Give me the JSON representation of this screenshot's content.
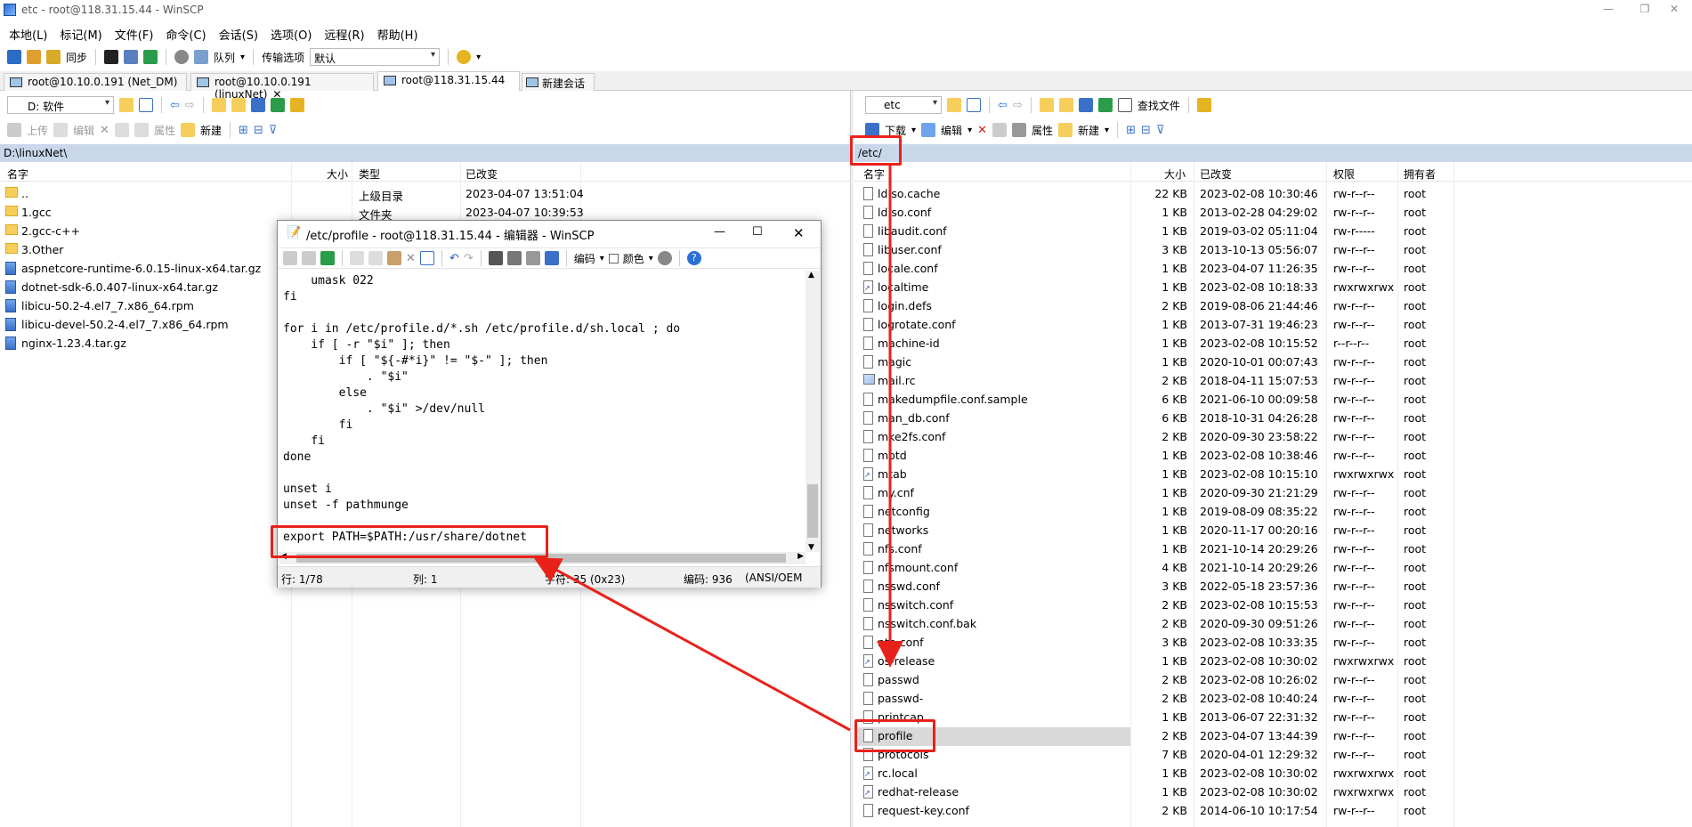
{
  "window": {
    "title": "etc - root@118.31.15.44 - WinSCP",
    "min": "—",
    "max": "❐",
    "close": "✕"
  },
  "menu": [
    "本地(L)",
    "标记(M)",
    "文件(F)",
    "命令(C)",
    "会话(S)",
    "选项(O)",
    "远程(R)",
    "帮助(H)"
  ],
  "toolbar": {
    "sync": "同步",
    "queue": "队列",
    "transfer_label": "传输选项",
    "transfer_value": "默认"
  },
  "tabs": [
    "root@10.10.0.191 (Net_DM)",
    "root@10.10.0.191 (linuxNet)",
    "root@118.31.15.44",
    "新建会话"
  ],
  "tab_close": "✕",
  "left": {
    "drive": "D: 软件",
    "actions": {
      "upload": "上传",
      "edit": "编辑",
      "props": "属性",
      "new": "新建"
    },
    "path": "D:\\linuxNet\\",
    "columns": {
      "name": "名字",
      "size": "大小",
      "type": "类型",
      "changed": "已改变"
    },
    "rows": [
      {
        "name": "..",
        "type": "上级目录",
        "changed": "2023-04-07  13:51:04"
      },
      {
        "name": "1.gcc",
        "type": "文件夹",
        "changed": "2023-04-07  10:39:53"
      },
      {
        "name": "2.gcc-c++"
      },
      {
        "name": "3.Other"
      },
      {
        "name": "aspnetcore-runtime-6.0.15-linux-x64.tar.gz"
      },
      {
        "name": "dotnet-sdk-6.0.407-linux-x64.tar.gz"
      },
      {
        "name": "libicu-50.2-4.el7_7.x86_64.rpm"
      },
      {
        "name": "libicu-devel-50.2-4.el7_7.x86_64.rpm"
      },
      {
        "name": "nginx-1.23.4.tar.gz"
      }
    ]
  },
  "right": {
    "dir": "etc",
    "find": "查找文件",
    "actions": {
      "download": "下载",
      "edit": "编辑",
      "props": "属性",
      "new": "新建"
    },
    "path": "/etc/",
    "columns": {
      "name": "名字",
      "size": "大小",
      "changed": "已改变",
      "rights": "权限",
      "owner": "拥有者"
    },
    "rows": [
      {
        "name": "ld.so.cache",
        "size": "22 KB",
        "changed": "2023-02-08 10:30:46",
        "rights": "rw-r--r--",
        "owner": "root"
      },
      {
        "name": "ld.so.conf",
        "size": "1 KB",
        "changed": "2013-02-28 04:29:02",
        "rights": "rw-r--r--",
        "owner": "root"
      },
      {
        "name": "libaudit.conf",
        "size": "1 KB",
        "changed": "2019-03-02 05:11:04",
        "rights": "rw-r-----",
        "owner": "root"
      },
      {
        "name": "libuser.conf",
        "size": "3 KB",
        "changed": "2013-10-13 05:56:07",
        "rights": "rw-r--r--",
        "owner": "root"
      },
      {
        "name": "locale.conf",
        "size": "1 KB",
        "changed": "2023-04-07 11:26:35",
        "rights": "rw-r--r--",
        "owner": "root"
      },
      {
        "name": "localtime",
        "size": "1 KB",
        "changed": "2023-02-08 10:18:33",
        "rights": "rwxrwxrwx",
        "owner": "root",
        "link": true
      },
      {
        "name": "login.defs",
        "size": "2 KB",
        "changed": "2019-08-06 21:44:46",
        "rights": "rw-r--r--",
        "owner": "root"
      },
      {
        "name": "logrotate.conf",
        "size": "1 KB",
        "changed": "2013-07-31 19:46:23",
        "rights": "rw-r--r--",
        "owner": "root"
      },
      {
        "name": "machine-id",
        "size": "1 KB",
        "changed": "2023-02-08 10:15:52",
        "rights": "r--r--r--",
        "owner": "root"
      },
      {
        "name": "magic",
        "size": "1 KB",
        "changed": "2020-10-01 00:07:43",
        "rights": "rw-r--r--",
        "owner": "root"
      },
      {
        "name": "mail.rc",
        "size": "2 KB",
        "changed": "2018-04-11 15:07:53",
        "rights": "rw-r--r--",
        "owner": "root",
        "img": true
      },
      {
        "name": "makedumpfile.conf.sample",
        "size": "6 KB",
        "changed": "2021-06-10 00:09:58",
        "rights": "rw-r--r--",
        "owner": "root"
      },
      {
        "name": "man_db.conf",
        "size": "6 KB",
        "changed": "2018-10-31 04:26:28",
        "rights": "rw-r--r--",
        "owner": "root"
      },
      {
        "name": "mke2fs.conf",
        "size": "2 KB",
        "changed": "2020-09-30 23:58:22",
        "rights": "rw-r--r--",
        "owner": "root"
      },
      {
        "name": "motd",
        "size": "1 KB",
        "changed": "2023-02-08 10:38:46",
        "rights": "rw-r--r--",
        "owner": "root"
      },
      {
        "name": "mtab",
        "size": "1 KB",
        "changed": "2023-02-08 10:15:10",
        "rights": "rwxrwxrwx",
        "owner": "root",
        "link": true
      },
      {
        "name": "my.cnf",
        "size": "1 KB",
        "changed": "2020-09-30 21:21:29",
        "rights": "rw-r--r--",
        "owner": "root"
      },
      {
        "name": "netconfig",
        "size": "1 KB",
        "changed": "2019-08-09 08:35:22",
        "rights": "rw-r--r--",
        "owner": "root"
      },
      {
        "name": "networks",
        "size": "1 KB",
        "changed": "2020-11-17 00:20:16",
        "rights": "rw-r--r--",
        "owner": "root"
      },
      {
        "name": "nfs.conf",
        "size": "1 KB",
        "changed": "2021-10-14 20:29:26",
        "rights": "rw-r--r--",
        "owner": "root"
      },
      {
        "name": "nfsmount.conf",
        "size": "4 KB",
        "changed": "2021-10-14 20:29:26",
        "rights": "rw-r--r--",
        "owner": "root"
      },
      {
        "name": "nsswd.conf",
        "size": "3 KB",
        "changed": "2022-05-18 23:57:36",
        "rights": "rw-r--r--",
        "owner": "root"
      },
      {
        "name": "nsswitch.conf",
        "size": "2 KB",
        "changed": "2023-02-08 10:15:53",
        "rights": "rw-r--r--",
        "owner": "root"
      },
      {
        "name": "nsswitch.conf.bak",
        "size": "2 KB",
        "changed": "2020-09-30 09:51:26",
        "rights": "rw-r--r--",
        "owner": "root"
      },
      {
        "name": "ntp.conf",
        "size": "3 KB",
        "changed": "2023-02-08 10:33:35",
        "rights": "rw-r--r--",
        "owner": "root"
      },
      {
        "name": "os-release",
        "size": "1 KB",
        "changed": "2023-02-08 10:30:02",
        "rights": "rwxrwxrwx",
        "owner": "root",
        "link": true
      },
      {
        "name": "passwd",
        "size": "2 KB",
        "changed": "2023-02-08 10:26:02",
        "rights": "rw-r--r--",
        "owner": "root"
      },
      {
        "name": "passwd-",
        "size": "2 KB",
        "changed": "2023-02-08 10:40:24",
        "rights": "rw-r--r--",
        "owner": "root"
      },
      {
        "name": "printcap",
        "size": "1 KB",
        "changed": "2013-06-07 22:31:32",
        "rights": "rw-r--r--",
        "owner": "root"
      },
      {
        "name": "profile",
        "size": "2 KB",
        "changed": "2023-04-07 13:44:39",
        "rights": "rw-r--r--",
        "owner": "root",
        "selected": true
      },
      {
        "name": "protocols",
        "size": "7 KB",
        "changed": "2020-04-01 12:29:32",
        "rights": "rw-r--r--",
        "owner": "root"
      },
      {
        "name": "rc.local",
        "size": "1 KB",
        "changed": "2023-02-08 10:30:02",
        "rights": "rwxrwxrwx",
        "owner": "root",
        "link": true
      },
      {
        "name": "redhat-release",
        "size": "1 KB",
        "changed": "2023-02-08 10:30:02",
        "rights": "rwxrwxrwx",
        "owner": "root",
        "link": true
      },
      {
        "name": "request-key.conf",
        "size": "2 KB",
        "changed": "2014-06-10 10:17:54",
        "rights": "rw-r--r--",
        "owner": "root"
      }
    ]
  },
  "editor": {
    "title": "/etc/profile - root@118.31.15.44 - 编辑器 - WinSCP",
    "encoding": "编码",
    "color": "颜色",
    "help": "?",
    "lines": [
      "    umask 022",
      "fi",
      "",
      "for i in /etc/profile.d/*.sh /etc/profile.d/sh.local ; do",
      "    if [ -r \"$i\" ]; then",
      "        if [ \"${-#*i}\" != \"$-\" ]; then",
      "            . \"$i\"",
      "        else",
      "            . \"$i\" >/dev/null",
      "        fi",
      "    fi",
      "done",
      "",
      "unset i",
      "unset -f pathmunge",
      "",
      "export PATH=$PATH:/usr/share/dotnet"
    ],
    "status": {
      "line": "行: 1/78",
      "col": "列: 1",
      "char": "字符: 35 (0x23)",
      "enc": "编码: 936",
      "mode": "(ANSI/OEM"
    }
  },
  "colors": {
    "annotation": "#e8221b",
    "path_bar": "#c9d7ea",
    "selection": "#d9d9d9"
  }
}
